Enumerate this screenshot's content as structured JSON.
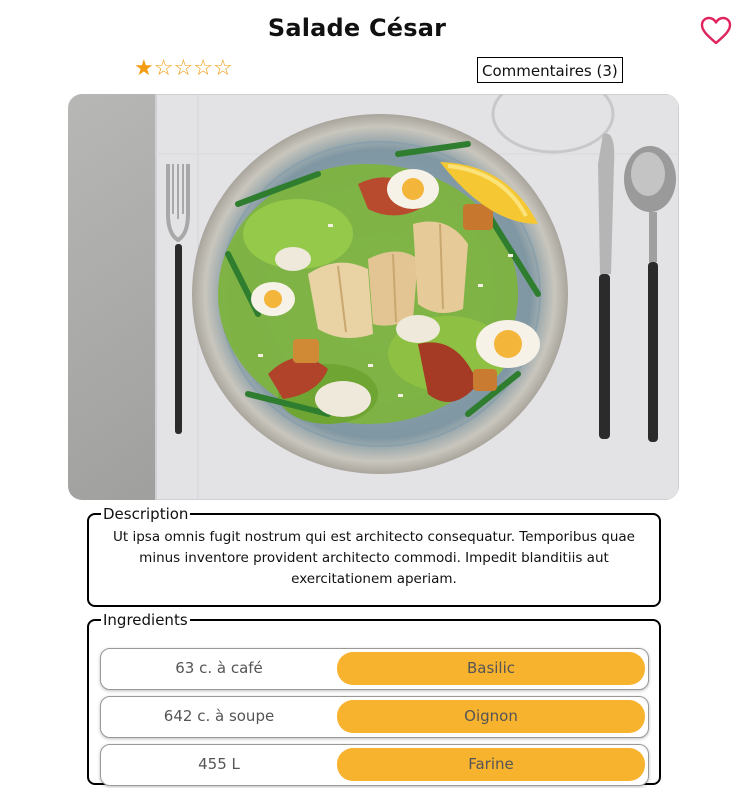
{
  "recipe": {
    "title": "Salade César",
    "rating": 1,
    "rating_max": 5,
    "comments_label": "Commentaires (3)"
  },
  "icons": {
    "favorite": "heart-outline-icon",
    "star_filled": "star-filled-icon",
    "star_empty": "star-outline-icon"
  },
  "colors": {
    "accent": "#f7b22e",
    "star": "#f39c12",
    "heart": "#e0245e"
  },
  "description": {
    "legend": "Description",
    "text": "Ut ipsa omnis fugit nostrum qui est architecto consequatur. Temporibus quae minus inventore provident architecto commodi. Impedit blanditiis aut exercitationem aperiam."
  },
  "ingredients": {
    "legend": "Ingredients",
    "items": [
      {
        "quantity": "63 c. à café",
        "name": "Basilic"
      },
      {
        "quantity": "642 c. à soupe",
        "name": "Oignon"
      },
      {
        "quantity": "455 L",
        "name": "Farine"
      }
    ]
  }
}
